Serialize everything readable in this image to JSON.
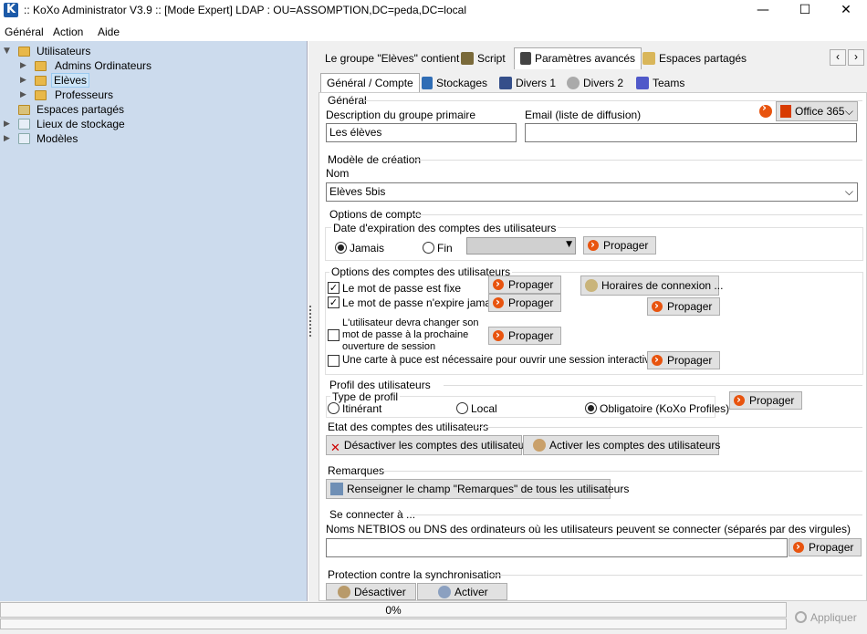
{
  "window": {
    "title": ":: KoXo Administrator V3.9 :: [Mode Expert] LDAP : OU=ASSOMPTION,DC=peda,DC=local",
    "icon_letter": "K",
    "minimize_glyph": "—",
    "maximize_glyph": "☐",
    "close_glyph": "✕"
  },
  "menu": {
    "general": "Général",
    "action": "Action",
    "aide": "Aide"
  },
  "tree": {
    "utilisateurs": "Utilisateurs",
    "admins": "Admins Ordinateurs",
    "eleves": "Elèves",
    "professeurs": "Professeurs",
    "espaces": "Espaces partagés",
    "lieux": "Lieux de stockage",
    "modeles": "Modèles"
  },
  "tabs_top": {
    "groupe": "Le groupe \"Elèves\" contient",
    "script": "Script",
    "params": "Paramètres avancés",
    "espaces": "Espaces partagés",
    "nav_prev": "‹",
    "nav_next": "›"
  },
  "tabs_sub": {
    "general": "Général / Compte",
    "stockages": "Stockages",
    "divers1": "Divers 1",
    "divers2": "Divers 2",
    "teams": "Teams"
  },
  "general": {
    "section": "Général",
    "desc_label": "Description du groupe primaire",
    "desc_value": "Les élèves",
    "email_label": "Email (liste de diffusion)",
    "email_value": "",
    "office_label": "Office 365",
    "office_chevron": "⌵"
  },
  "modele": {
    "section": "Modèle de création",
    "nom_label": "Nom",
    "nom_value": "Elèves 5bis",
    "chevron": "⌵"
  },
  "options_compte": {
    "section": "Options de compte",
    "expiration_label": "Date d'expiration des comptes des utilisateurs",
    "jamais": "Jamais",
    "fin": "Fin",
    "date_arrow": "▼",
    "propager": "Propager"
  },
  "options_utilisateurs": {
    "section": "Options des comptes des utilisateurs",
    "mdp_fixe": "Le mot de passe est fixe",
    "mdp_fixe_checked": "✓",
    "mdp_nexpire": "Le mot de passe n'expire jamais",
    "mdp_nexpire_checked": "✓",
    "changer_mdp": "L'utilisateur devra changer son mot de passe à la prochaine ouverture de session",
    "carte_puce": "Une carte à puce est nécessaire pour ouvrir une session interactive",
    "horaires": "Horaires de connexion ...",
    "propager": "Propager"
  },
  "profil": {
    "section": "Profil des utilisateurs",
    "type_label": "Type de profil",
    "itinerant": "Itinérant",
    "local": "Local",
    "obligatoire": "Obligatoire (KoXo Profiles)",
    "propager": "Propager"
  },
  "etat": {
    "section": "Etat des comptes des utilisateurs",
    "desactiver": "Désactiver les comptes des utilisateurs",
    "activer": "Activer les comptes des utilisateurs"
  },
  "remarques": {
    "section": "Remarques",
    "renseigner": "Renseigner le champ \"Remarques\" de tous les utilisateurs"
  },
  "connecter": {
    "section": "Se connecter à ...",
    "label": "Noms NETBIOS ou DNS des ordinateurs où les utilisateurs peuvent se connecter (séparés par des virgules)",
    "value": "",
    "propager": "Propager"
  },
  "protection": {
    "section": "Protection contre la synchronisation",
    "desactiver": "Désactiver",
    "activer": "Activer"
  },
  "status": {
    "progress_text": "0%",
    "progress_value": 0,
    "appliquer": "Appliquer"
  },
  "colors": {
    "tree_bg": "#ccdbed",
    "accent_orange": "#e8540f",
    "office_red": "#d83b01",
    "teams_purple": "#5059c9"
  }
}
